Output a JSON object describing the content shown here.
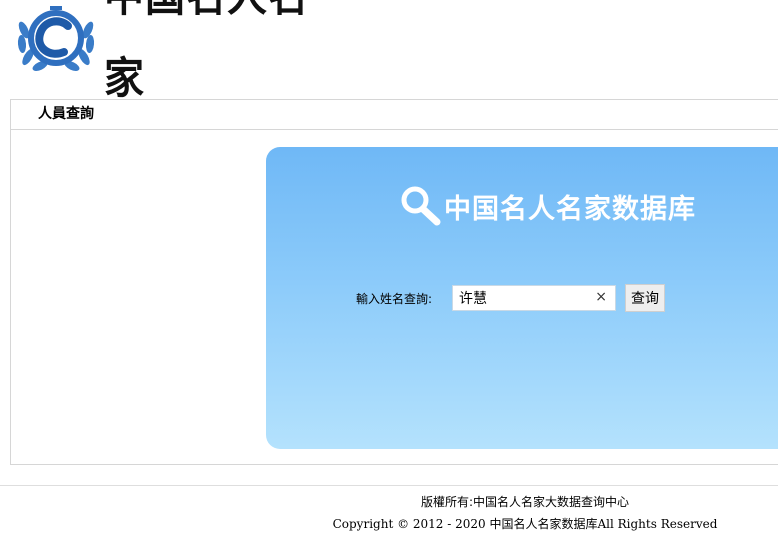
{
  "header": {
    "logo_text": "中国名人名家",
    "logo_colors": {
      "ring": "#2f6fbf",
      "letter": "#1e5aa8"
    }
  },
  "panel": {
    "title": "人員查詢"
  },
  "search": {
    "banner_title": "中国名人名家数据库",
    "label": "輸入姓名查詢:",
    "input_value": "许慧",
    "clear_symbol": "×",
    "button_label": "查询",
    "gradient": {
      "top": "#6fb8f6",
      "bottom": "#b4e2fd"
    }
  },
  "footer": {
    "line1": "版權所有:中国名人名家大数据查询中心",
    "line2": "Copyright © 2012 - 2020 中国名人名家数据库All Rights Reserved"
  }
}
